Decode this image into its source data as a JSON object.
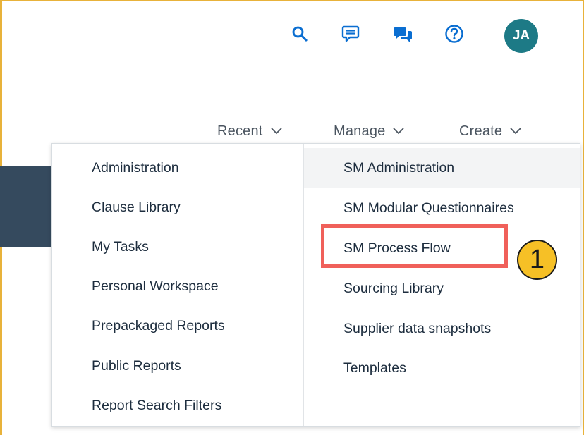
{
  "header": {
    "icons": [
      "search-icon",
      "feedback-icon",
      "chat-icon",
      "help-icon"
    ],
    "avatar_initials": "JA",
    "accent_color": "#0a6ed1",
    "avatar_color": "#1d7a86"
  },
  "nav": {
    "recent_label": "Recent",
    "manage_label": "Manage",
    "create_label": "Create"
  },
  "dropdown": {
    "left_items": [
      "Administration",
      "Clause Library",
      "My Tasks",
      "Personal Workspace",
      "Prepackaged Reports",
      "Public Reports",
      "Report Search Filters"
    ],
    "right_items": [
      "SM Administration",
      "SM Modular Questionnaires",
      "SM Process Flow",
      "Sourcing Library",
      "Supplier data snapshots",
      "Templates"
    ]
  },
  "annotation": {
    "step_number": "1",
    "highlight_color": "#f0605a",
    "badge_color": "#f6c026"
  }
}
